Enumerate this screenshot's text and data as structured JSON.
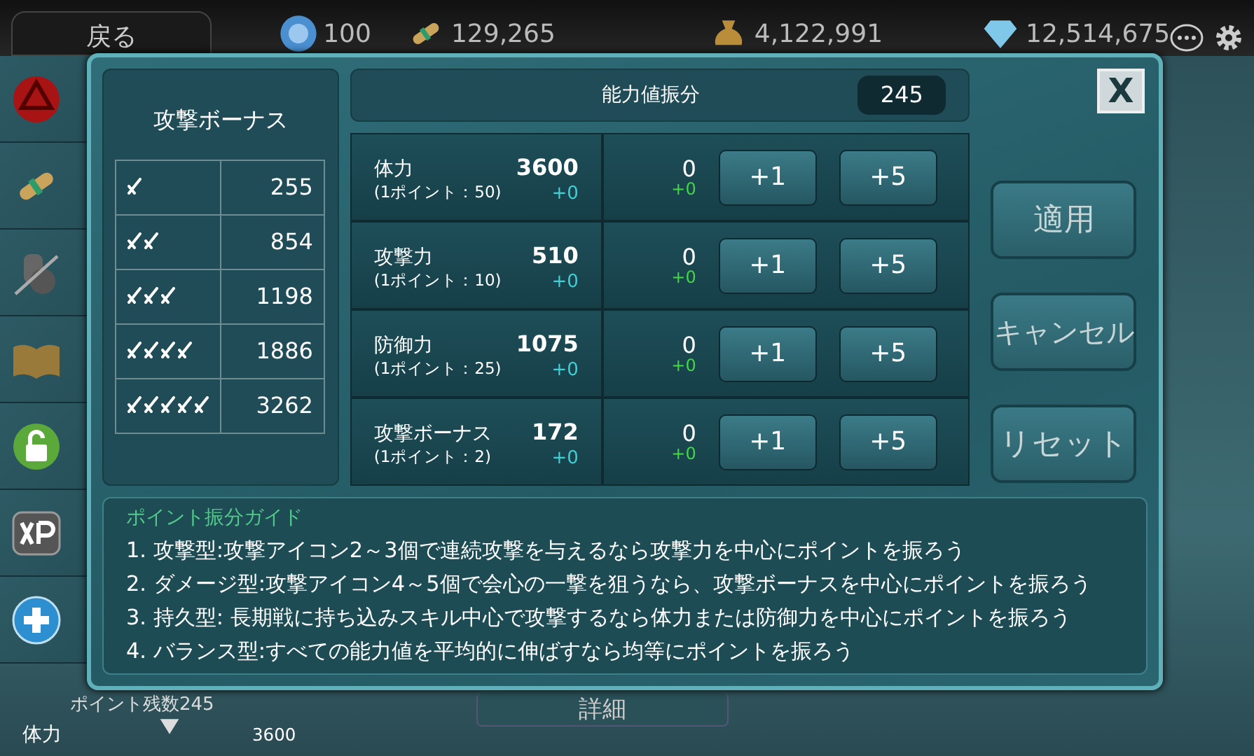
{
  "top_bar": {
    "back_label": "戻る",
    "currencies": [
      {
        "kind": "orb",
        "value": "100"
      },
      {
        "kind": "scroll",
        "value": "129,265"
      },
      {
        "kind": "bag",
        "value": "4,122,991"
      },
      {
        "kind": "gem",
        "value": "12,514,675"
      }
    ]
  },
  "sidebar": {
    "items": [
      {
        "kind": "seal"
      },
      {
        "kind": "scroll"
      },
      {
        "kind": "gear"
      },
      {
        "kind": "book"
      },
      {
        "kind": "lock"
      },
      {
        "kind": "xp"
      },
      {
        "kind": "plus"
      }
    ],
    "points_remaining": "ポイント残数245"
  },
  "background_bottom": {
    "stat_label": "体力",
    "stat_value": "3600",
    "detail_button": "詳細"
  },
  "dialog": {
    "bonus_panel": {
      "title": "攻撃ボーナス",
      "rows": [
        {
          "icons": [
            {
              "kind": "sword"
            }
          ],
          "value": "255"
        },
        {
          "icons": [
            {
              "kind": "sword"
            },
            {
              "kind": "sword"
            }
          ],
          "value": "854"
        },
        {
          "icons": [
            {
              "kind": "sword"
            },
            {
              "kind": "sword"
            },
            {
              "kind": "sword"
            }
          ],
          "value": "1198"
        },
        {
          "icons": [
            {
              "kind": "sword"
            },
            {
              "kind": "sword"
            },
            {
              "kind": "sword"
            },
            {
              "kind": "sword"
            }
          ],
          "value": "1886"
        },
        {
          "icons": [
            {
              "kind": "sword"
            },
            {
              "kind": "sword"
            },
            {
              "kind": "sword"
            },
            {
              "kind": "sword"
            },
            {
              "kind": "sword"
            }
          ],
          "value": "3262"
        }
      ]
    },
    "header": {
      "title": "能力値振分",
      "points": "245"
    },
    "stats": [
      {
        "name": "体力",
        "rate": "(1ポイント：50)",
        "value": "3600",
        "bonus": "+0",
        "alloc": "0",
        "alloc_delta": "+0",
        "buttons": [
          "+1",
          "+5"
        ]
      },
      {
        "name": "攻撃力",
        "rate": "(1ポイント：10)",
        "value": "510",
        "bonus": "+0",
        "alloc": "0",
        "alloc_delta": "+0",
        "buttons": [
          "+1",
          "+5"
        ]
      },
      {
        "name": "防御力",
        "rate": "(1ポイント：25)",
        "value": "1075",
        "bonus": "+0",
        "alloc": "0",
        "alloc_delta": "+0",
        "buttons": [
          "+1",
          "+5"
        ]
      },
      {
        "name": "攻撃ボーナス",
        "rate": "(1ポイント：2)",
        "value": "172",
        "bonus": "+0",
        "alloc": "0",
        "alloc_delta": "+0",
        "buttons": [
          "+1",
          "+5"
        ]
      }
    ],
    "actions": [
      "適用",
      "キャンセル",
      "リセット"
    ],
    "close": "X",
    "guide": {
      "title": "ポイント振分ガイド",
      "lines": [
        "1. 攻撃型:攻撃アイコン2～3個で連続攻撃を与えるなら攻撃力を中心にポイントを振ろう",
        "2. ダメージ型:攻撃アイコン4～5個で会心の一撃を狙うなら、攻撃ボーナスを中心にポイントを振ろう",
        "3. 持久型: 長期戦に持ち込みスキル中心で攻撃するなら体力または防御力を中心にポイントを振ろう",
        "4. バランス型:すべての能力値を平均的に伸ばすなら均等にポイントを振ろう"
      ]
    }
  }
}
